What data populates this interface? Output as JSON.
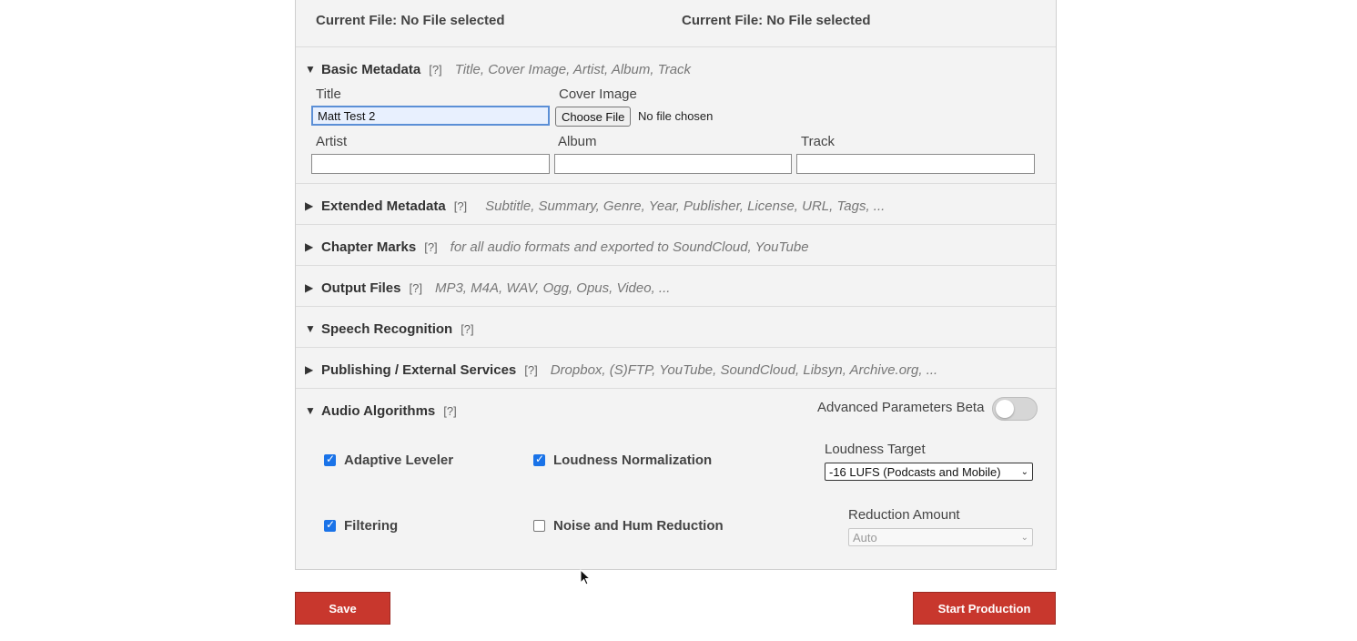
{
  "files": {
    "left_current": "Current File: No File selected",
    "right_current": "Current File: No File selected"
  },
  "basic_metadata": {
    "arrow": "▼",
    "title": "Basic Metadata",
    "help": "[?]",
    "desc": "Title, Cover Image, Artist, Album, Track",
    "title_label": "Title",
    "title_value": "Matt Test 2",
    "cover_label": "Cover Image",
    "choose_file": "Choose File",
    "no_file": "No file chosen",
    "artist_label": "Artist",
    "artist_value": "",
    "album_label": "Album",
    "album_value": "",
    "track_label": "Track",
    "track_value": ""
  },
  "sections": [
    {
      "arrow": "▶",
      "title": "Extended Metadata",
      "help": "[?]",
      "desc": "Subtitle, Summary, Genre, Year, Publisher, License, URL, Tags, ..."
    },
    {
      "arrow": "▶",
      "title": "Chapter Marks",
      "help": "[?]",
      "desc": "for all audio formats and exported to SoundCloud, YouTube"
    },
    {
      "arrow": "▶",
      "title": "Output Files",
      "help": "[?]",
      "desc": "MP3, M4A, WAV, Ogg, Opus, Video, ..."
    },
    {
      "arrow": "▼",
      "title": "Speech Recognition",
      "help": "[?]",
      "desc": ""
    },
    {
      "arrow": "▶",
      "title": "Publishing / External Services",
      "help": "[?]",
      "desc": "Dropbox, (S)FTP, YouTube, SoundCloud, Libsyn, Archive.org, ..."
    }
  ],
  "audio": {
    "arrow": "▼",
    "title": "Audio Algorithms",
    "help": "[?]",
    "advanced_label": "Advanced Parameters Beta",
    "advanced_on": false,
    "adaptive_leveler": "Adaptive Leveler",
    "adaptive_leveler_checked": true,
    "loudness_normalization": "Loudness Normalization",
    "loudness_normalization_checked": true,
    "loudness_target_label": "Loudness Target",
    "loudness_target_value": "-16 LUFS (Podcasts and Mobile)",
    "filtering": "Filtering",
    "filtering_checked": true,
    "noise_hum": "Noise and Hum Reduction",
    "noise_hum_checked": false,
    "reduction_label": "Reduction Amount",
    "reduction_value": "Auto"
  },
  "buttons": {
    "save": "Save",
    "start": "Start Production"
  },
  "colors": {
    "accent_red": "#c8372d",
    "checkbox_blue": "#1a73e8"
  }
}
